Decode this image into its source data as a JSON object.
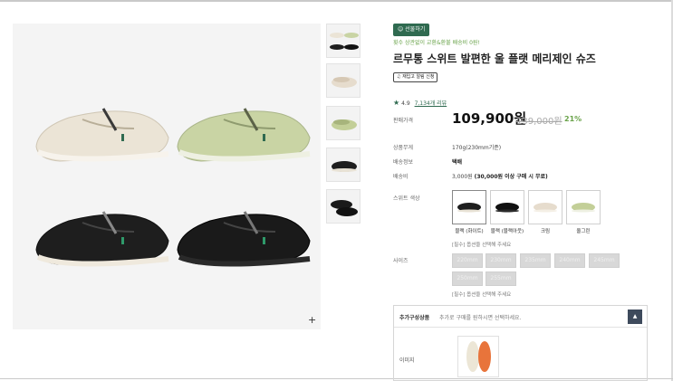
{
  "product": {
    "badge": "☺ 선물하기",
    "promo": "횟수 상관없이 교환&환불 배송비 0원!",
    "title": "르무통 스위트 발편한 울 플랫 메리제인 슈즈",
    "restock_alert": "♫ 재입고 알림 신청",
    "rating": {
      "star": "★",
      "score": "4.9",
      "reviews": "7,134개 리뷰"
    },
    "price_label": "판매가격",
    "price": "109,900원",
    "original_price": "139,000원",
    "discount": "21%",
    "specs": [
      {
        "label": "상품무게",
        "value": "170g(230mm기준)"
      },
      {
        "label": "배송정보",
        "value": "택배"
      },
      {
        "label": "배송비",
        "value": "3,000원",
        "value_bold": "(30,000원 이상 구매 시 무료)"
      }
    ],
    "color_label": "스위트 색상",
    "colors": [
      {
        "name": "블랙 (화이트)"
      },
      {
        "name": "블랙 (블랙아웃)"
      },
      {
        "name": "크림"
      },
      {
        "name": "올그린"
      }
    ],
    "required_note": "[필수] 옵션을 선택해 주세요",
    "size_label": "사이즈",
    "sizes": [
      "220mm",
      "230mm",
      "235mm",
      "240mm",
      "245mm",
      "250mm",
      "255mm"
    ],
    "addon": {
      "title": "추가구성상품",
      "desc": "추가로 구매를 원하시면 선택하세요.",
      "toggle": "▲",
      "image_label": "이미지"
    }
  },
  "gallery": {
    "zoom": "+"
  },
  "colors": {
    "brand_green": "#2f6a50",
    "accent_green": "#6aa34a",
    "cream": "#ece6da",
    "sage": "#c9d4a6",
    "black": "#1c1c1c"
  }
}
